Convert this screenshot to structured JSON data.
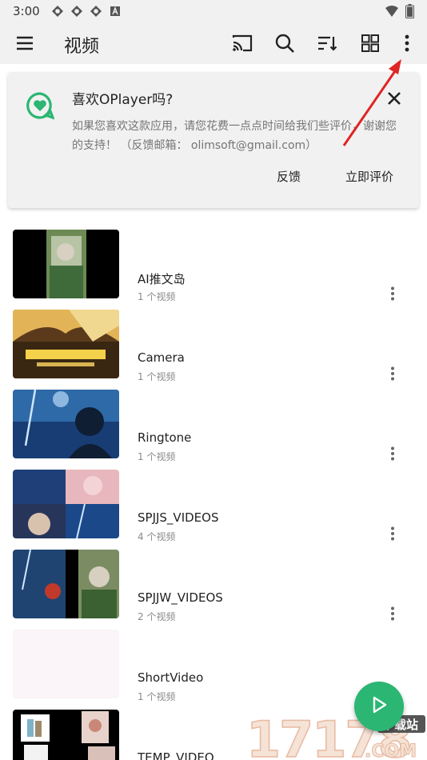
{
  "status_bar": {
    "time": "3:00",
    "left_icons": [
      "app-notification-icon",
      "app-notification-icon",
      "app-notification-icon",
      "a-box-icon"
    ],
    "right_icons": [
      "wifi-icon",
      "battery-icon"
    ]
  },
  "app_bar": {
    "title": "视频",
    "actions": [
      "cast-icon",
      "search-icon",
      "sort-icon",
      "grid-view-icon",
      "more-vert-icon"
    ]
  },
  "rate_card": {
    "title": "喜欢OPlayer吗?",
    "description": "如果您喜欢这款应用，请您花费一点点时间给我们些评价，谢谢您的支持！ （反馈邮箱： olimsoft@gmail.com）",
    "feedback_label": "反馈",
    "rate_label": "立即评价",
    "accent_color": "#2bb673"
  },
  "folders": [
    {
      "name": "AI推文岛",
      "count": "1 个视频"
    },
    {
      "name": "Camera",
      "count": "1 个视频"
    },
    {
      "name": "Ringtone",
      "count": "1 个视频"
    },
    {
      "name": "SPJJS_VIDEOS",
      "count": "4 个视频"
    },
    {
      "name": "SPJJW_VIDEOS",
      "count": "2 个视频"
    },
    {
      "name": "ShortVideo",
      "count": "1 个视频"
    },
    {
      "name": "TEMP_VIDEO",
      "count": ""
    }
  ],
  "fab": {
    "icon": "play-icon",
    "color": "#2bb673"
  },
  "watermark": {
    "brand": "17178",
    "suffix": ".COM",
    "badge": "下载站"
  },
  "annotation": {
    "color": "#e02424"
  }
}
